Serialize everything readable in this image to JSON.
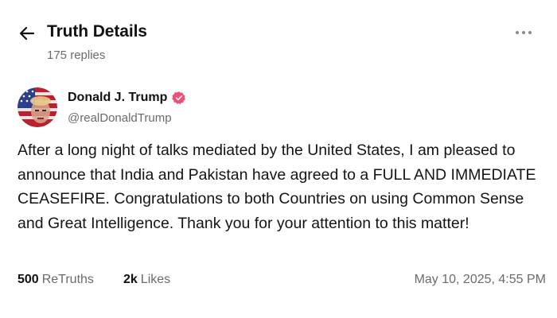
{
  "header": {
    "title": "Truth Details",
    "replies": "175 replies",
    "back_icon": "arrow-left-icon",
    "more_icon": "more-horizontal-icon"
  },
  "author": {
    "name": "Donald J. Trump",
    "handle": "@realDonaldTrump",
    "verified_icon": "verified-badge-icon",
    "verified_color": "#f04e77"
  },
  "post": {
    "text": "After a long night of talks mediated by the United States, I am pleased to announce that India and Pakistan have agreed to a FULL AND IMMEDIATE CEASEFIRE. Congratulations to both Countries on using Common Sense and Great Intelligence. Thank you for your attention to this matter!"
  },
  "footer": {
    "retruths_count": "500",
    "retruths_label": "ReTruths",
    "likes_count": "2k",
    "likes_label": "Likes",
    "timestamp": "May 10, 2025, 4:55 PM"
  }
}
